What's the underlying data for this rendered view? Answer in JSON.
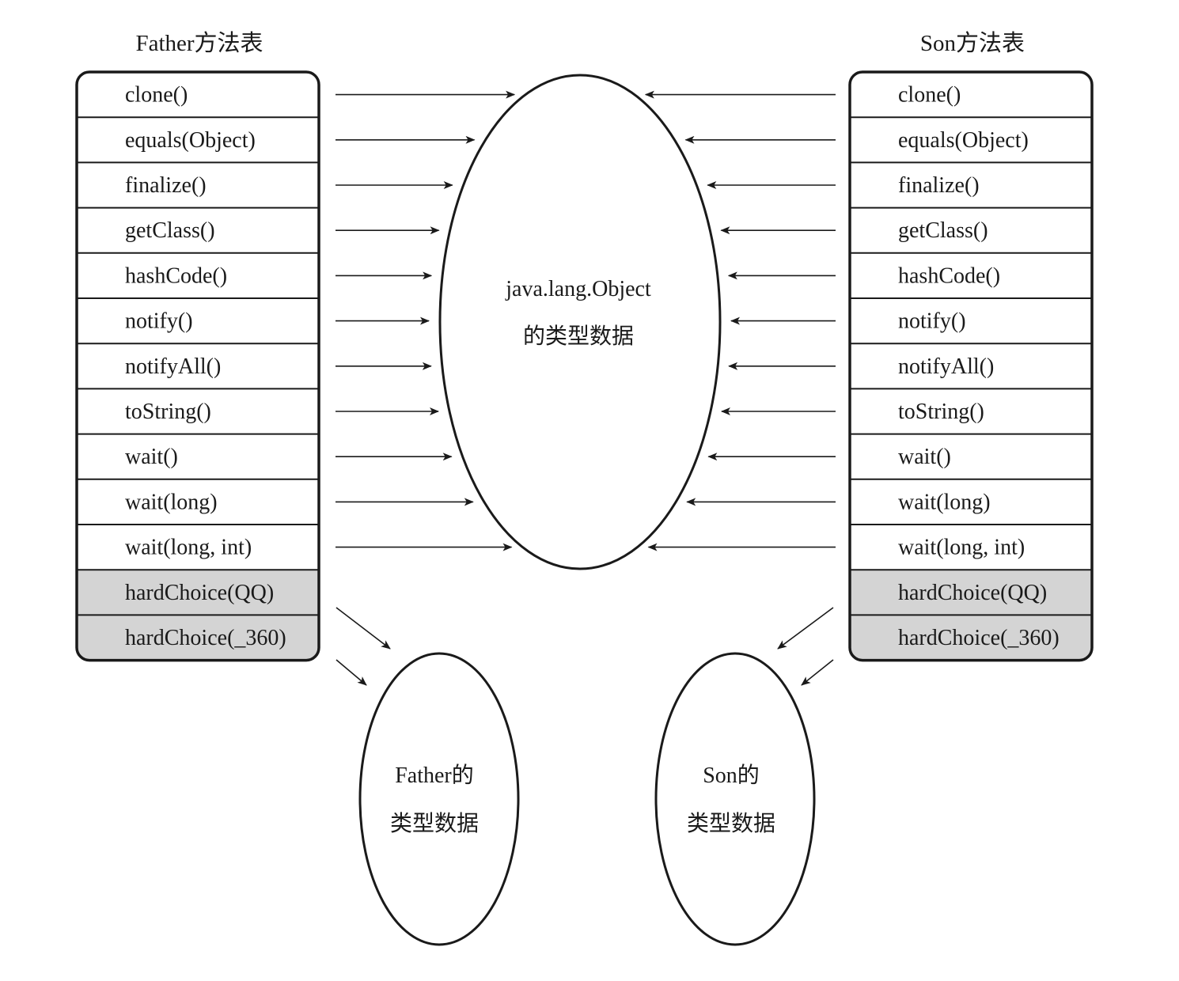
{
  "colors": {
    "line": "#1a1a1a",
    "highlight_fill": "#d4d4d4",
    "background": "#ffffff"
  },
  "father_table": {
    "title": "Father方法表",
    "rows": [
      {
        "label": "clone()",
        "highlighted": false
      },
      {
        "label": "equals(Object)",
        "highlighted": false
      },
      {
        "label": "finalize()",
        "highlighted": false
      },
      {
        "label": "getClass()",
        "highlighted": false
      },
      {
        "label": "hashCode()",
        "highlighted": false
      },
      {
        "label": "notify()",
        "highlighted": false
      },
      {
        "label": "notifyAll()",
        "highlighted": false
      },
      {
        "label": "toString()",
        "highlighted": false
      },
      {
        "label": "wait()",
        "highlighted": false
      },
      {
        "label": "wait(long)",
        "highlighted": false
      },
      {
        "label": "wait(long, int)",
        "highlighted": false
      },
      {
        "label": "hardChoice(QQ)",
        "highlighted": true
      },
      {
        "label": "hardChoice(_360)",
        "highlighted": true
      }
    ]
  },
  "son_table": {
    "title": "Son方法表",
    "rows": [
      {
        "label": "clone()",
        "highlighted": false
      },
      {
        "label": "equals(Object)",
        "highlighted": false
      },
      {
        "label": "finalize()",
        "highlighted": false
      },
      {
        "label": "getClass()",
        "highlighted": false
      },
      {
        "label": "hashCode()",
        "highlighted": false
      },
      {
        "label": "notify()",
        "highlighted": false
      },
      {
        "label": "notifyAll()",
        "highlighted": false
      },
      {
        "label": "toString()",
        "highlighted": false
      },
      {
        "label": "wait()",
        "highlighted": false
      },
      {
        "label": "wait(long)",
        "highlighted": false
      },
      {
        "label": "wait(long, int)",
        "highlighted": false
      },
      {
        "label": "hardChoice(QQ)",
        "highlighted": true
      },
      {
        "label": "hardChoice(_360)",
        "highlighted": true
      }
    ]
  },
  "object_node": {
    "line1": "java.lang.Object",
    "line2": "的类型数据"
  },
  "father_node": {
    "line1": "Father的",
    "line2": "类型数据"
  },
  "son_node": {
    "line1": "Son的",
    "line2": "类型数据"
  }
}
